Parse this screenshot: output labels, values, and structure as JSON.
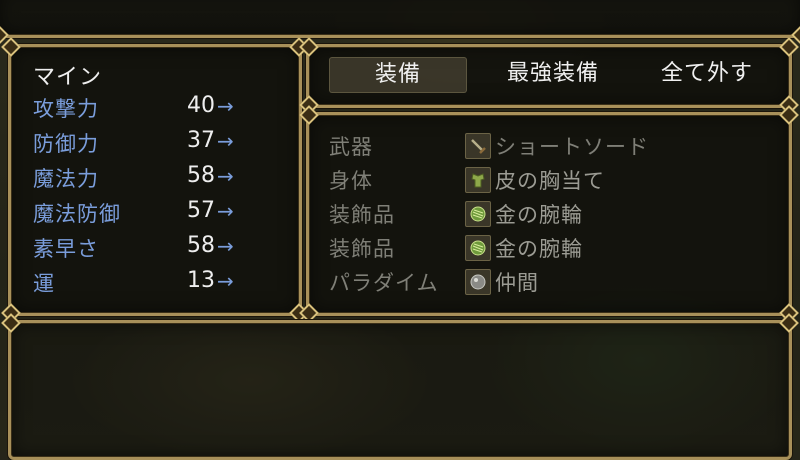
{
  "status": {
    "actor_name": "マイン",
    "stats": [
      {
        "label": "攻撃力",
        "value": "40",
        "arrow": "→"
      },
      {
        "label": "防御力",
        "value": "37",
        "arrow": "→"
      },
      {
        "label": "魔法力",
        "value": "58",
        "arrow": "→"
      },
      {
        "label": "魔法防御",
        "value": "57",
        "arrow": "→"
      },
      {
        "label": "素早さ",
        "value": "58",
        "arrow": "→"
      },
      {
        "label": "運",
        "value": "13",
        "arrow": "→"
      }
    ]
  },
  "commands": [
    {
      "label": "装備",
      "selected": true
    },
    {
      "label": "最強装備",
      "selected": false
    },
    {
      "label": "全て外す",
      "selected": false
    }
  ],
  "equipment": [
    {
      "slot": "武器",
      "item": "ショートソード",
      "icon": "sword-icon"
    },
    {
      "slot": "身体",
      "item": "皮の胸当て",
      "icon": "armor-icon"
    },
    {
      "slot": "装飾品",
      "item": "金の腕輪",
      "icon": "bracelet-icon"
    },
    {
      "slot": "装飾品",
      "item": "金の腕輪",
      "icon": "bracelet-icon"
    },
    {
      "slot": "パラダイム",
      "item": "仲間",
      "icon": "orb-icon"
    }
  ],
  "colors": {
    "frame_gold": "#a8905a",
    "stat_label_blue": "#7a9ddb",
    "text_white": "#eeeeee",
    "disabled_gray": "#7f7f77"
  }
}
